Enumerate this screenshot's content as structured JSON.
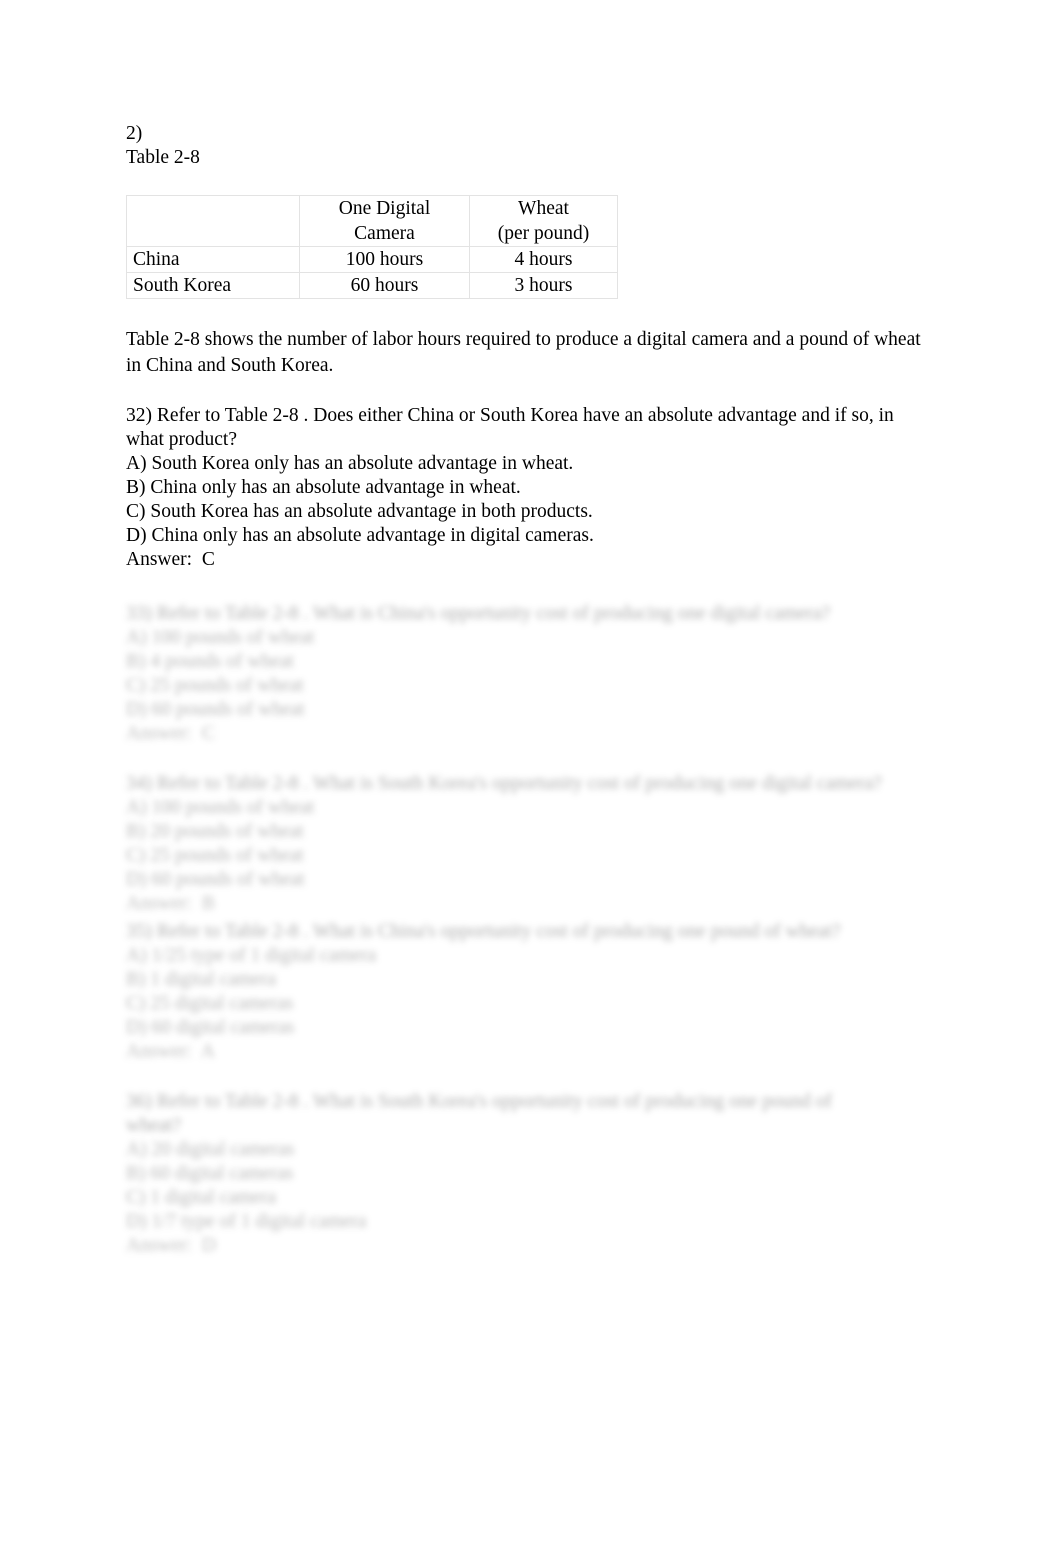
{
  "document": {
    "item_number": "2)",
    "table_caption": "Table 2-8"
  },
  "table": {
    "name": "Table 2-8",
    "columns": [
      "",
      "One  Digital Camera",
      "Wheat (per pound)"
    ],
    "column_header_lines": [
      [
        "",
        ""
      ],
      [
        "One  Digital",
        "Camera"
      ],
      [
        "Wheat",
        "(per pound)"
      ]
    ],
    "rows": [
      {
        "country": "China",
        "camera": "100 hours",
        "wheat": "4 hours"
      },
      {
        "country": "South Korea",
        "camera": "60 hours",
        "wheat": "3 hours"
      }
    ]
  },
  "description": {
    "line1": "Table 2-8 shows the number of labor hours required to produce a digital camera and a pound of",
    "line2": "wheat in China and South Korea."
  },
  "question_32": {
    "stem_line1": "32) Refer to Table 2-8 . Does either China or South Korea have an absolute advantage and if so,",
    "stem_line2": "in what product?",
    "options": [
      "A) South Korea only has an absolute advantage in wheat.",
      "B) China only has an absolute advantage in wheat.",
      "C) South Korea has an absolute advantage in both products.",
      "D) China only has an absolute advantage in digital cameras."
    ],
    "answer_label": "Answer:  C"
  },
  "redacted_blocks": [
    {
      "stem_line1": "33) Refer to Table 2-8 . What is China's opportunity cost of producing one digital camera?",
      "stem_line2": "",
      "options": [
        "A) 100 pounds of wheat",
        "B) 4 pounds of wheat",
        "C) 25 pounds of wheat",
        "D) 60 pounds of wheat"
      ],
      "answer_label": "Answer:  C"
    },
    {
      "stem_line1": "34) Refer to Table 2-8 . What is South Korea's opportunity cost of producing one digital camera?",
      "stem_line2": "",
      "options": [
        "A) 100 pounds of wheat",
        "B) 20 pounds of wheat",
        "C) 25 pounds of wheat",
        "D) 60 pounds of wheat"
      ],
      "answer_label": "Answer:  B"
    },
    {
      "stem_line1": "35) Refer to Table 2-8 . What is China's opportunity cost of producing one pound of wheat?",
      "stem_line2": "",
      "options": [
        "A) 1/25 type of 1 digital camera",
        "B) 1 digital camera",
        "C) 25 digital cameras",
        "D) 60 digital cameras"
      ],
      "answer_label": "Answer:  A"
    },
    {
      "stem_line1": "36) Refer to Table 2-8 . What is South Korea's opportunity cost of producing one pound of",
      "stem_line2": "wheat?",
      "options": [
        "A) 20 digital cameras",
        "B) 60 digital cameras",
        "C) 1 digital camera",
        "D) 1/7 type of 1 digital camera"
      ],
      "answer_label": "Answer:  D"
    }
  ]
}
